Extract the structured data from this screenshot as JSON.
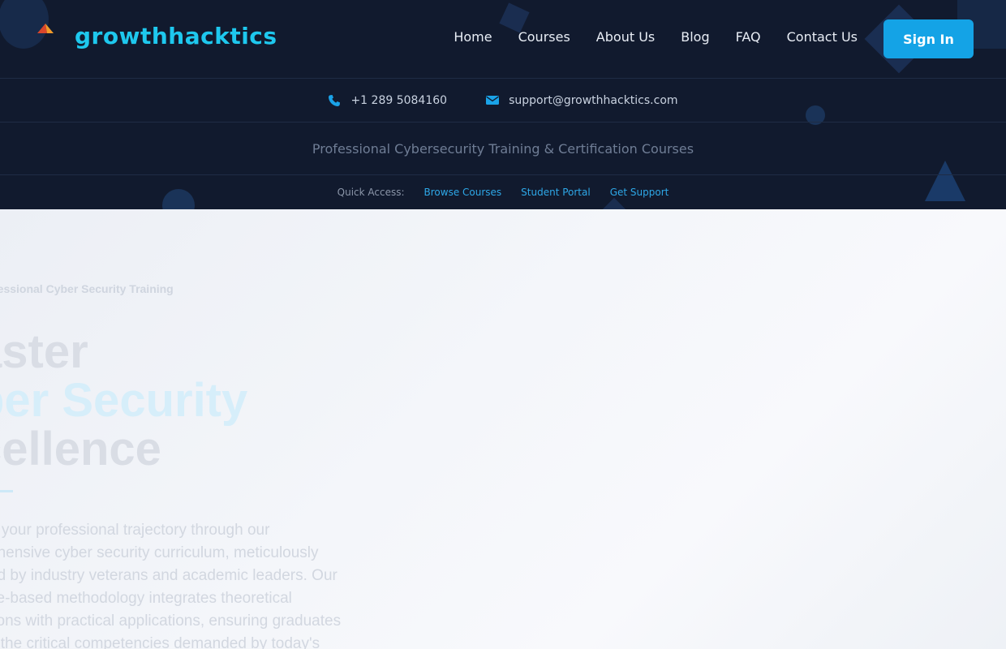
{
  "brand": {
    "name": "growthhacktics"
  },
  "nav": {
    "links": [
      "Home",
      "Courses",
      "About Us",
      "Blog",
      "FAQ",
      "Contact Us"
    ],
    "signin_label": "Sign In"
  },
  "contact": {
    "phone": "+1 289 5084160",
    "email": "support@growthhacktics.com"
  },
  "tagline": "Professional Cybersecurity Training & Certification Courses",
  "quick_access": {
    "label": "Quick Access:",
    "links": [
      "Browse Courses",
      "Student Portal",
      "Get Support"
    ]
  },
  "hero": {
    "eyebrow": "fessional Cyber Security Training",
    "title_lines": [
      "aster",
      "ber Security",
      "cellence"
    ],
    "description_lines": [
      "e your professional trajectory through our",
      "ehensive cyber security curriculum, meticulously",
      "ed by industry veterans and academic leaders. Our",
      "ce-based methodology integrates theoretical",
      "tions with practical applications, ensuring graduates",
      "s the critical competencies demanded by today's"
    ]
  },
  "colors": {
    "header_bg": "#111a2e",
    "brand": "#1ec8ee",
    "accent": "#14a3e6",
    "link": "#2ea8e8"
  },
  "icons": [
    "logo-mark-icon",
    "phone-icon",
    "envelope-icon"
  ]
}
